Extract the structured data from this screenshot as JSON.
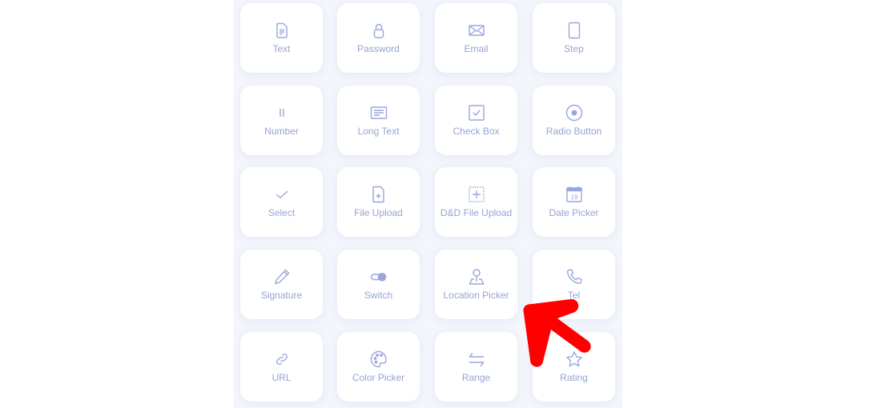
{
  "palette": {
    "panel_bg": "#f4f6fc",
    "card_bg": "#ffffff",
    "icon_color": "#9aa6da",
    "label_color": "#97a3d4",
    "annotation_arrow": "#ff0000"
  },
  "fields": [
    {
      "label": "Text",
      "icon": "document-text-icon"
    },
    {
      "label": "Password",
      "icon": "lock-icon"
    },
    {
      "label": "Email",
      "icon": "envelope-icon"
    },
    {
      "label": "Step",
      "icon": "rectangle-icon"
    },
    {
      "label": "Number",
      "icon": "number-bars-icon"
    },
    {
      "label": "Long Text",
      "icon": "text-box-icon"
    },
    {
      "label": "Check Box",
      "icon": "checkbox-icon"
    },
    {
      "label": "Radio Button",
      "icon": "radio-icon"
    },
    {
      "label": "Select",
      "icon": "checkmark-icon"
    },
    {
      "label": "File Upload",
      "icon": "file-plus-icon"
    },
    {
      "label": "D&D File Upload",
      "icon": "dashed-plus-box-icon"
    },
    {
      "label": "Date Picker",
      "icon": "calendar-icon"
    },
    {
      "label": "Signature",
      "icon": "pencil-icon"
    },
    {
      "label": "Switch",
      "icon": "toggle-icon"
    },
    {
      "label": "Location Picker",
      "icon": "location-pin-icon"
    },
    {
      "label": "Tel",
      "icon": "phone-icon"
    },
    {
      "label": "URL",
      "icon": "link-icon"
    },
    {
      "label": "Color Picker",
      "icon": "palette-icon"
    },
    {
      "label": "Range",
      "icon": "swap-arrows-icon"
    },
    {
      "label": "Rating",
      "icon": "star-icon"
    }
  ],
  "calendar_day": "19"
}
